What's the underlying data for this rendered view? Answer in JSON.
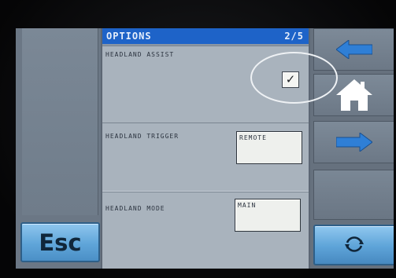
{
  "header": {
    "title": "OPTIONS",
    "page": "2/5"
  },
  "options": [
    {
      "label": "HEADLAND ASSIST",
      "control": "checkbox",
      "checked": true,
      "mark": "✓"
    },
    {
      "label": "HEADLAND TRIGGER",
      "control": "value",
      "value": "REMOTE"
    },
    {
      "label": "HEADLAND MODE",
      "control": "value",
      "value": "MAIN"
    }
  ],
  "buttons": {
    "esc_label": "Esc",
    "back_icon": "left-arrow-icon",
    "home_icon": "home-icon",
    "next_icon": "right-arrow-icon",
    "cycle_icon": "cycle-icon"
  },
  "colors": {
    "header_bar": "#1e63c8",
    "accent_button": "#5fa5d9",
    "arrow_icon": "#2f7fd6",
    "home_icon": "#ffffff",
    "highlight_ring": "#eef1f4"
  }
}
